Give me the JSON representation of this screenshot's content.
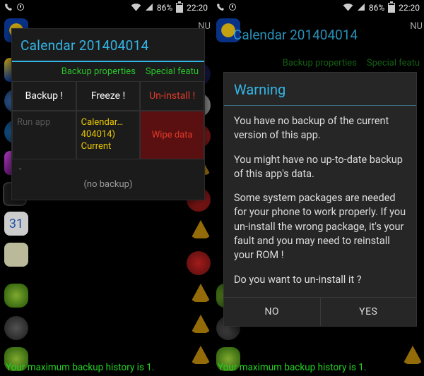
{
  "status": {
    "battery_pct": "86%",
    "time": "22:20"
  },
  "appbar_fragment": "NU",
  "left_dialog": {
    "title": "Calendar 201404014",
    "link_props": "Backup properties",
    "link_special": "Special featu",
    "btn_backup": "Backup !",
    "btn_freeze": "Freeze !",
    "btn_uninstall": "Un-install !",
    "run_app": "Run app",
    "pkg_line1": "Calendar…404014)",
    "pkg_line2": "Current",
    "wipe_data": "Wipe data",
    "dash": "-",
    "no_backup": "(no backup)"
  },
  "right_bg": {
    "title": "Calendar 201404014",
    "link_props": "Backup properties",
    "link_special": "Special featu"
  },
  "warning": {
    "title": "Warning",
    "p1": "You have no backup of the current version of this app.",
    "p2": "You might have no up-to-date backup of this app's data.",
    "p3": "Some system packages are needed for your phone to work properly. If you un-install the wrong package, it's your fault and you may need to reinstall your ROM !",
    "p4": "Do you want to un-install it ?",
    "no": "NO",
    "yes": "YES"
  },
  "footer": "Your maximum backup history is 1."
}
